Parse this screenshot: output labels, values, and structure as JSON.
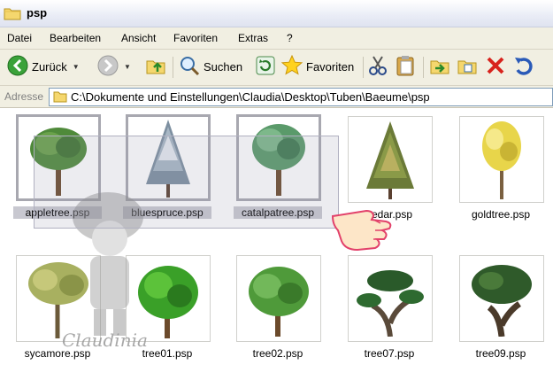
{
  "window": {
    "title": "psp"
  },
  "menu": [
    "Datei",
    "Bearbeiten",
    "Ansicht",
    "Favoriten",
    "Extras",
    "?"
  ],
  "toolbar": {
    "back_label": "Zurück",
    "search_label": "Suchen",
    "favorites_label": "Favoriten"
  },
  "address": {
    "label": "Adresse",
    "path": "C:\\Dokumente und Einstellungen\\Claudia\\Desktop\\Tuben\\Baeume\\psp"
  },
  "files": [
    {
      "name": "appletree.psp",
      "selected": true
    },
    {
      "name": "bluespruce.psp",
      "selected": true
    },
    {
      "name": "catalpatree.psp",
      "selected": true
    },
    {
      "name": "cedar.psp",
      "selected": false
    },
    {
      "name": "goldtree.psp",
      "selected": false
    },
    {
      "name": "sycamore.psp",
      "selected": false
    },
    {
      "name": "tree01.psp",
      "selected": false
    },
    {
      "name": "tree02.psp",
      "selected": false
    },
    {
      "name": "tree07.psp",
      "selected": false
    },
    {
      "name": "tree09.psp",
      "selected": false
    }
  ],
  "watermark": {
    "text": "Claudinia"
  },
  "colors": {
    "selection": "#c8c8d0",
    "chrome": "#f1efe2"
  }
}
